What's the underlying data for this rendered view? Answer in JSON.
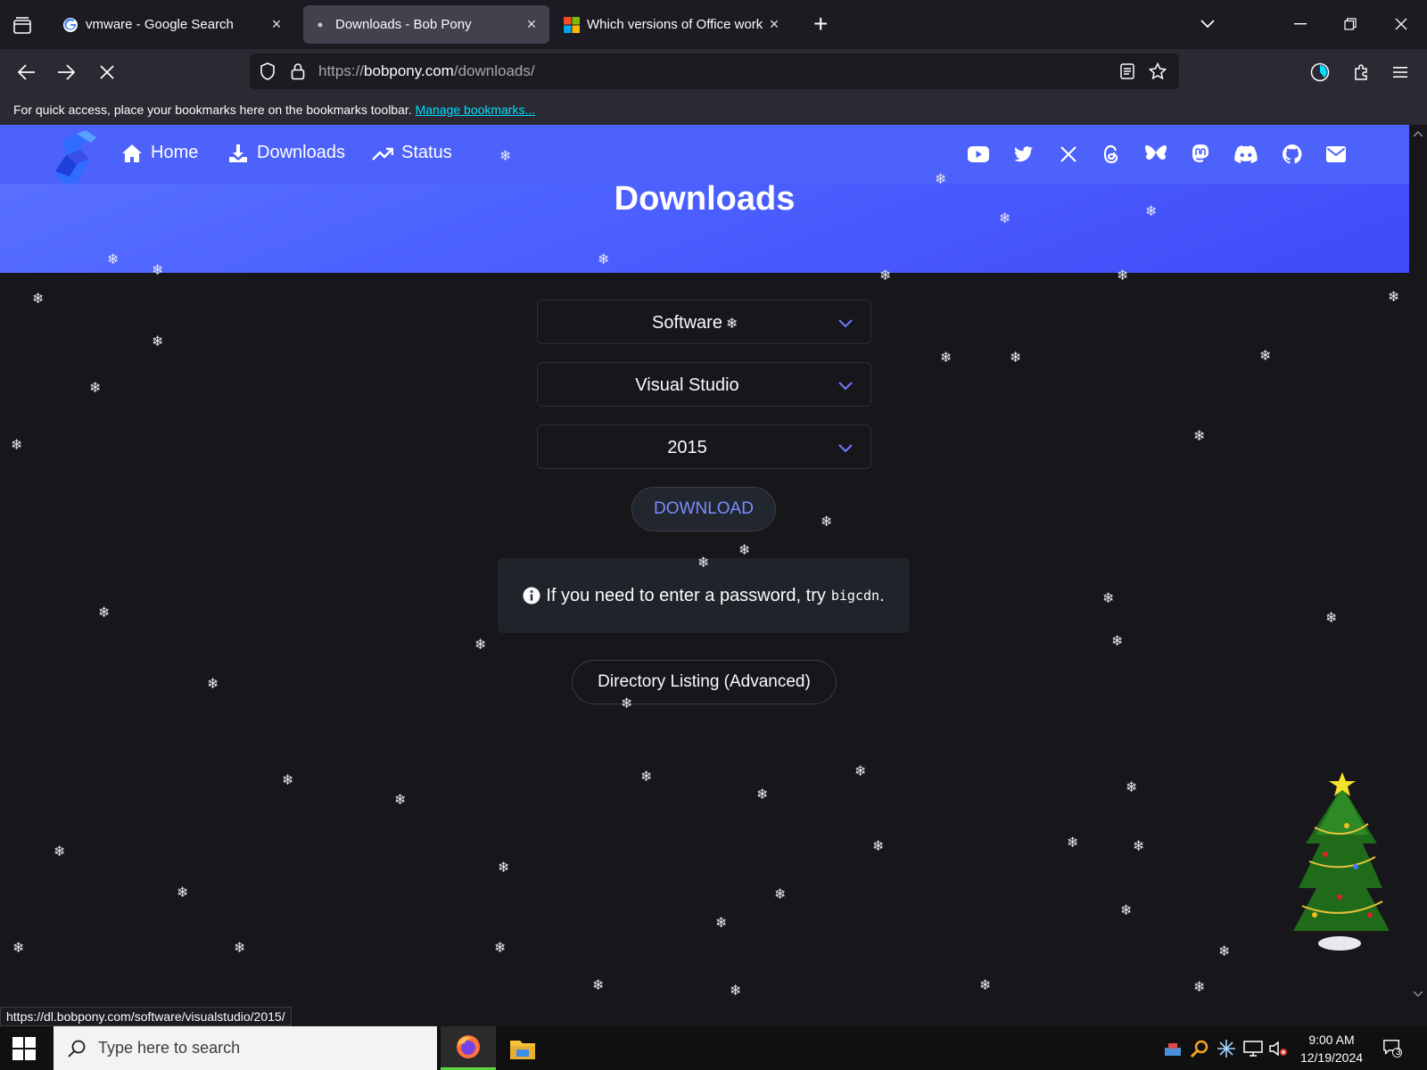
{
  "browser": {
    "tabs": [
      {
        "title": "vmware - Google Search",
        "active": false
      },
      {
        "title": "Downloads - Bob Pony",
        "active": true
      },
      {
        "title": "Which versions of Office work w",
        "active": false
      }
    ],
    "url_prefix": "https://",
    "url_domain": "bobpony.com",
    "url_path": "/downloads/",
    "bookmarks_hint": "For quick access, place your bookmarks here on the bookmarks toolbar.",
    "bookmarks_link": "Manage bookmarks...",
    "status_url": "https://dl.bobpony.com/software/visualstudio/2015/"
  },
  "site": {
    "nav": {
      "home": "Home",
      "downloads": "Downloads",
      "status": "Status"
    },
    "social_icons": [
      "youtube-icon",
      "twitter-icon",
      "x-icon",
      "threads-icon",
      "bluesky-icon",
      "mastodon-icon",
      "discord-icon",
      "github-icon",
      "mail-icon"
    ],
    "page_title": "Downloads",
    "selects": {
      "category": "Software",
      "product": "Visual Studio",
      "version": "2015"
    },
    "download_button": "DOWNLOAD",
    "info": {
      "text": "If you need to enter a password, try",
      "password": "bigcdn",
      "suffix": "."
    },
    "directory_button": "Directory Listing (Advanced)",
    "colors": {
      "accent": "#4d61fb",
      "button_text": "#7b8cff"
    }
  },
  "taskbar": {
    "search_placeholder": "Type here to search",
    "time": "9:00 AM",
    "date": "12/19/2024",
    "notification_count": "3"
  }
}
